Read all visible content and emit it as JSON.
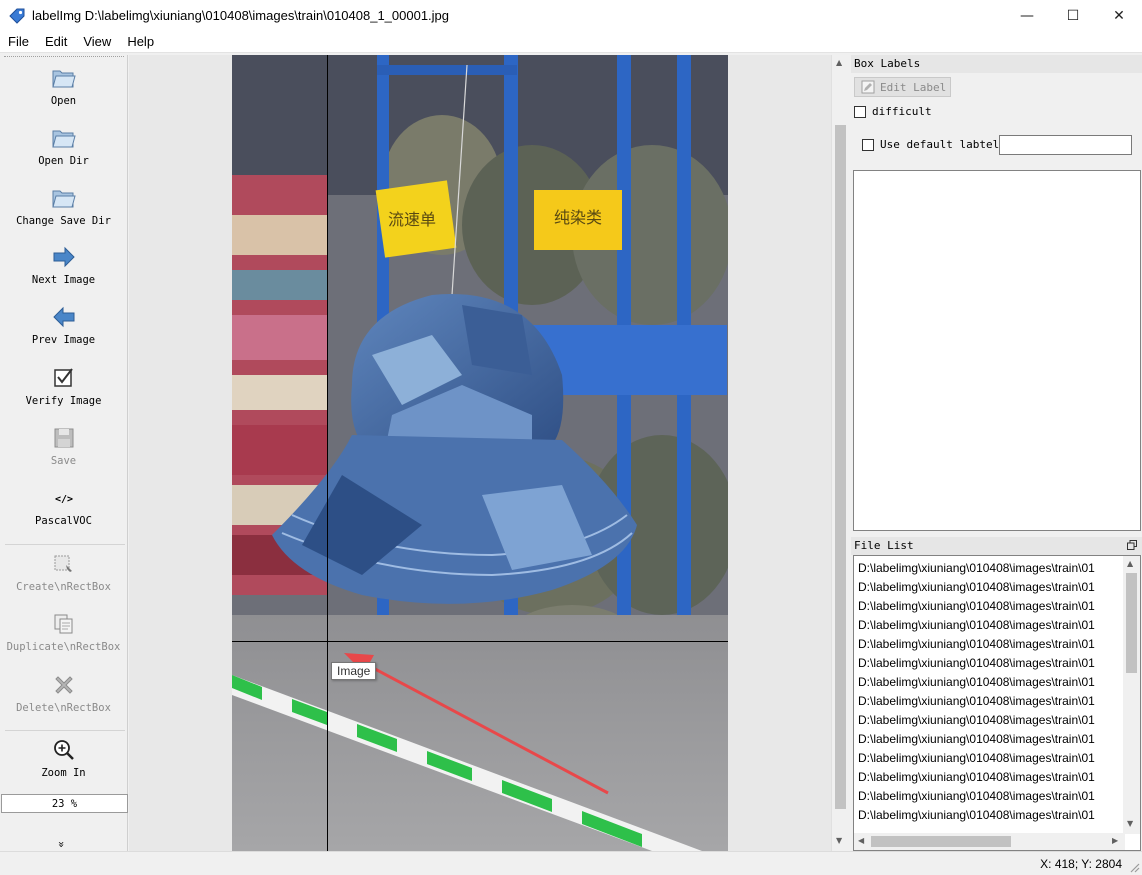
{
  "window": {
    "title": "labelImg D:\\labelimg\\xiuniang\\010408\\images\\train\\010408_1_00001.jpg",
    "minimize": "—",
    "maximize": "☐",
    "close": "✕"
  },
  "menu": [
    {
      "label": "File"
    },
    {
      "label": "Edit"
    },
    {
      "label": "View"
    },
    {
      "label": "Help"
    }
  ],
  "toolbar": {
    "open": "Open",
    "open_dir": "Open Dir",
    "change_save_dir": "Change Save Dir",
    "next_image": "Next Image",
    "prev_image": "Prev Image",
    "verify_image": "Verify Image",
    "save": "Save",
    "format": "PascalVOC",
    "create_rect": "Create\\nRectBox",
    "duplicate_rect": "Duplicate\\nRectBox",
    "delete_rect": "Delete\\nRectBox",
    "zoom_in": "Zoom In",
    "zoom_value": "23 %",
    "more": "»"
  },
  "canvas": {
    "tooltip": "Image",
    "tags": [
      "流速单",
      "纯染类"
    ],
    "accent_arrow": "#e8484a"
  },
  "box_labels": {
    "title": "Box Labels",
    "edit_label": "Edit Label",
    "difficult": "difficult",
    "use_default": "Use default labtel",
    "default_value": ""
  },
  "file_list": {
    "title": "File List",
    "items": [
      "D:\\labelimg\\xiuniang\\010408\\images\\train\\01",
      "D:\\labelimg\\xiuniang\\010408\\images\\train\\01",
      "D:\\labelimg\\xiuniang\\010408\\images\\train\\01",
      "D:\\labelimg\\xiuniang\\010408\\images\\train\\01",
      "D:\\labelimg\\xiuniang\\010408\\images\\train\\01",
      "D:\\labelimg\\xiuniang\\010408\\images\\train\\01",
      "D:\\labelimg\\xiuniang\\010408\\images\\train\\01",
      "D:\\labelimg\\xiuniang\\010408\\images\\train\\01",
      "D:\\labelimg\\xiuniang\\010408\\images\\train\\01",
      "D:\\labelimg\\xiuniang\\010408\\images\\train\\01",
      "D:\\labelimg\\xiuniang\\010408\\images\\train\\01",
      "D:\\labelimg\\xiuniang\\010408\\images\\train\\01",
      "D:\\labelimg\\xiuniang\\010408\\images\\train\\01",
      "D:\\labelimg\\xiuniang\\010408\\images\\train\\01"
    ]
  },
  "status": {
    "coords": "X: 418; Y: 2804"
  }
}
